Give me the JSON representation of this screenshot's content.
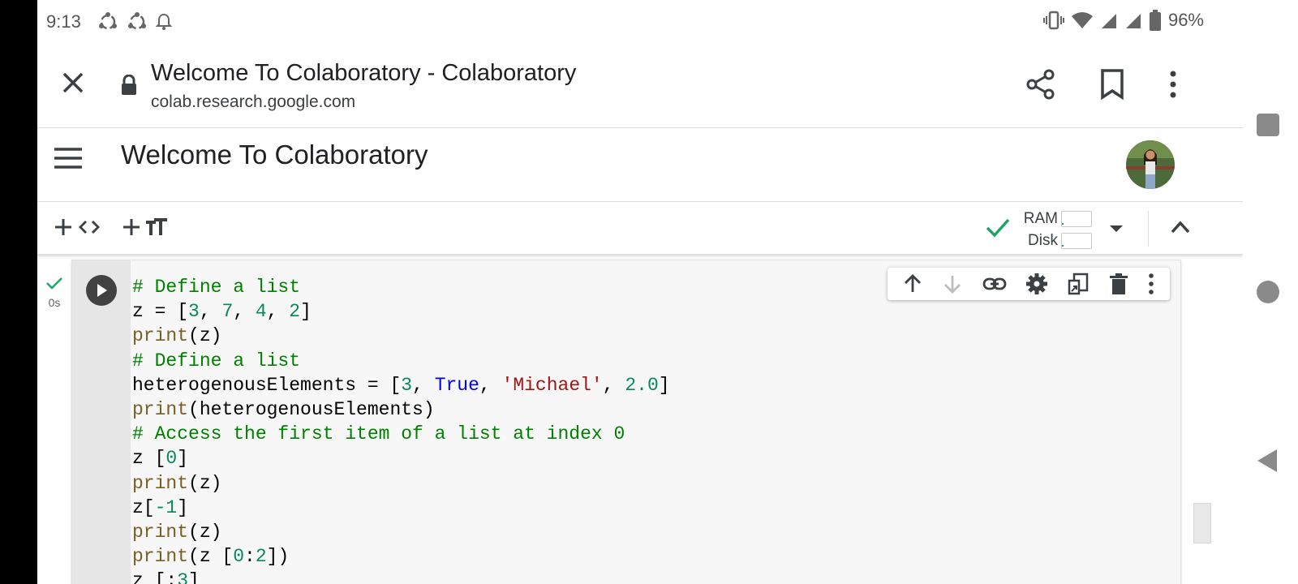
{
  "status_bar": {
    "time": "9:13",
    "battery_percent": "96%",
    "icons": [
      "sync-icon",
      "sync-icon",
      "notification-bell-icon",
      "vibrate-icon",
      "wifi-icon",
      "signal-icon",
      "signal-icon",
      "battery-icon"
    ]
  },
  "browser": {
    "page_title": "Welcome To Colaboratory - Colaboratory",
    "url": "colab.research.google.com",
    "icons": [
      "close-icon",
      "lock-icon",
      "share-icon",
      "bookmark-icon",
      "more-vert-icon"
    ]
  },
  "notebook": {
    "title": "Welcome To Colaboratory"
  },
  "toolbar": {
    "add_code_icon": "add-code-icon",
    "add_text_icon": "add-text-icon",
    "ram_label": "RAM",
    "disk_label": "Disk",
    "ram_usage": 0.05,
    "disk_usage": 0.05,
    "status_color": "#21a366"
  },
  "cell": {
    "exec_time": "0s",
    "toolbar_icons": [
      "move-up-icon",
      "move-down-icon",
      "link-icon",
      "settings-icon",
      "mirror-cell-icon",
      "delete-icon",
      "more-vert-icon"
    ]
  },
  "colors": {
    "comment": "#008000",
    "number": "#09885a",
    "keyword": "#0000ff",
    "string": "#a31515",
    "function": "#795e26"
  }
}
